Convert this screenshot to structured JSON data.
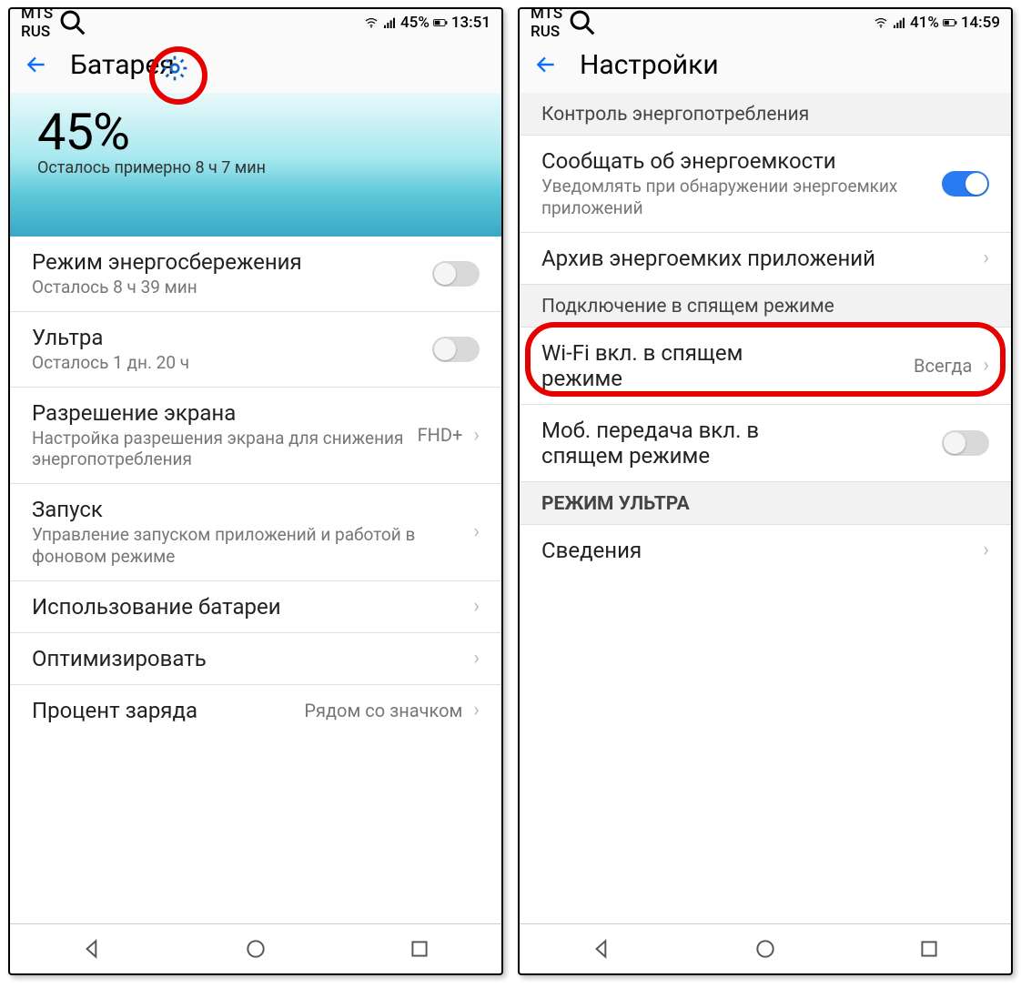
{
  "left": {
    "status": {
      "carrier": "MTS RUS",
      "battery": "45%",
      "time": "13:51"
    },
    "header": {
      "title": "Батарея"
    },
    "hero": {
      "pct": "45%",
      "sub": "Осталось примерно 8 ч 7 мин"
    },
    "items": {
      "powersave": {
        "title": "Режим энергосбережения",
        "sub": "Осталось 8 ч 39 мин"
      },
      "ultra": {
        "title": "Ультра",
        "sub": "Осталось 1 дн. 20 ч"
      },
      "resolution": {
        "title": "Разрешение экрана",
        "sub": "Настройка разрешения экрана для снижения энергопотребления",
        "value": "FHD+"
      },
      "launch": {
        "title": "Запуск",
        "sub": "Управление запуском приложений и работой в фоновом режиме"
      },
      "usage": {
        "title": "Использование батареи"
      },
      "optimize": {
        "title": "Оптимизировать"
      },
      "percent": {
        "title": "Процент заряда",
        "value": "Рядом со значком"
      }
    }
  },
  "right": {
    "status": {
      "carrier": "MTS RUS",
      "battery": "41%",
      "time": "14:59"
    },
    "header": {
      "title": "Настройки"
    },
    "sections": {
      "s1": "Контроль энергопотребления",
      "s2": "Подключение в спящем режиме",
      "s3": "РЕЖИМ УЛЬТРА"
    },
    "items": {
      "notify": {
        "title": "Сообщать об энергоемкости",
        "sub": "Уведомлять при обнаружении энергоемких приложений"
      },
      "archive": {
        "title": "Архив энергоемких приложений"
      },
      "wifi": {
        "title": "Wi-Fi вкл. в спящем режиме",
        "value": "Всегда"
      },
      "mobile": {
        "title": "Моб. передача вкл. в спящем режиме"
      },
      "info": {
        "title": "Сведения"
      }
    }
  }
}
